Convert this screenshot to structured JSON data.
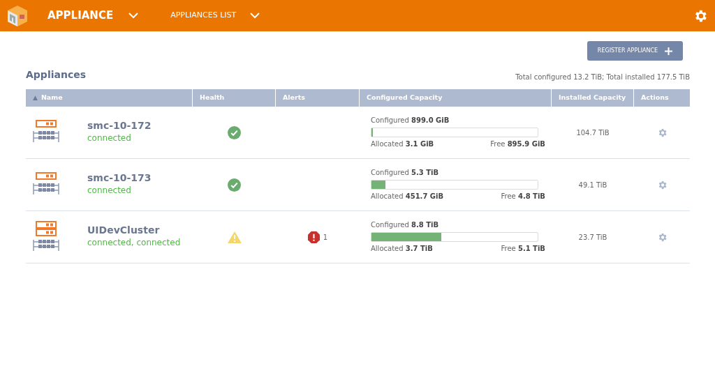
{
  "header": {
    "app_menu": "APPLIANCE",
    "view_menu": "APPLIANCES LIST"
  },
  "register_button": "REGISTER APPLIANCE",
  "title": "Appliances",
  "totals": "Total configured 13.2 TiB; Total installed 177.5 TiB",
  "table": {
    "columns": [
      {
        "label": "Name",
        "sort": "▲"
      },
      {
        "label": "Health"
      },
      {
        "label": "Alerts"
      },
      {
        "label": "Configured Capacity"
      },
      {
        "label": "Installed Capacity"
      },
      {
        "label": "Actions"
      }
    ],
    "rows": [
      {
        "kind": "single",
        "name": "smc-10-172",
        "status": "connected",
        "health": {
          "kind": "ok"
        },
        "configured": "Configured **899.0 GiB**",
        "level": 0.005,
        "allocated": "Allocated **3.1 GiB**",
        "free": "Free **895.9 GiB**",
        "installed": "104.7 TiB"
      },
      {
        "kind": "single",
        "name": "smc-10-173",
        "status": "connected",
        "health": {
          "kind": "ok"
        },
        "configured": "Configured **5.3 TiB**",
        "level": 0.085,
        "allocated": "Allocated **451.7 GiB**",
        "free": "Free **4.8 TiB**",
        "installed": "49.1 TiB"
      },
      {
        "kind": "cluster",
        "name": "UIDevCluster",
        "status": "connected, connected",
        "health": {
          "kind": "warning"
        },
        "alerts": "1",
        "configured": "Configured **8.8 TiB**",
        "level": 0.42,
        "allocated": "Allocated **3.7 TiB**",
        "free": "Free **5.1 TiB**",
        "installed": "23.7 TiB"
      }
    ]
  }
}
